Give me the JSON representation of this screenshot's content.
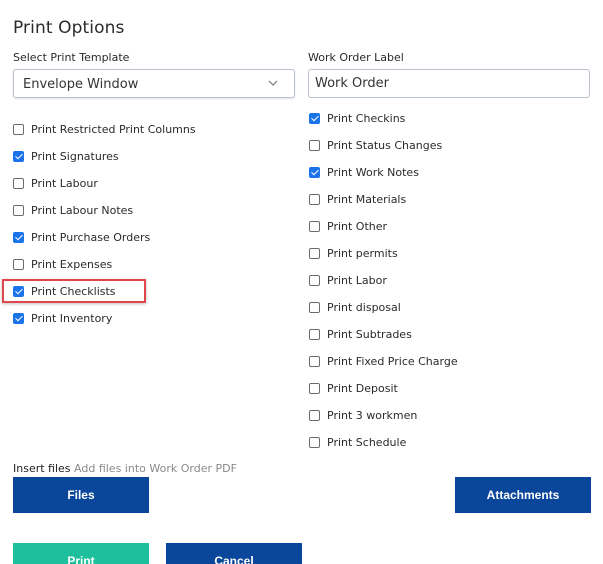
{
  "title": "Print Options",
  "template_select": {
    "label": "Select Print Template",
    "value": "Envelope Window"
  },
  "work_order_label": {
    "label": "Work Order Label",
    "value": "Work Order"
  },
  "left_options": [
    {
      "label": "Print Restricted Print Columns",
      "checked": false
    },
    {
      "label": "Print Signatures",
      "checked": true
    },
    {
      "label": "Print Labour",
      "checked": false
    },
    {
      "label": "Print Labour Notes",
      "checked": false
    },
    {
      "label": "Print Purchase Orders",
      "checked": true
    },
    {
      "label": "Print Expenses",
      "checked": false
    },
    {
      "label": "Print Checklists",
      "checked": true
    },
    {
      "label": "Print Inventory",
      "checked": true
    }
  ],
  "right_options": [
    {
      "label": "Print Checkins",
      "checked": true
    },
    {
      "label": "Print Status Changes",
      "checked": false
    },
    {
      "label": "Print Work Notes",
      "checked": true
    },
    {
      "label": "Print Materials",
      "checked": false
    },
    {
      "label": "Print Other",
      "checked": false
    },
    {
      "label": "Print permits",
      "checked": false
    },
    {
      "label": "Print Labor",
      "checked": false
    },
    {
      "label": "Print disposal",
      "checked": false
    },
    {
      "label": "Print Subtrades",
      "checked": false
    },
    {
      "label": "Print Fixed Price Charge",
      "checked": false
    },
    {
      "label": "Print Deposit",
      "checked": false
    },
    {
      "label": "Print 3 workmen",
      "checked": false
    },
    {
      "label": "Print Schedule",
      "checked": false
    }
  ],
  "insert_files": {
    "label": "Insert files",
    "hint": "Add files into Work Order PDF"
  },
  "buttons": {
    "files": "Files",
    "attachments": "Attachments",
    "print": "Print",
    "cancel": "Cancel"
  },
  "colors": {
    "primary_blue": "#0a479a",
    "print_green": "#1ebf9c",
    "checkbox_blue": "#1a73e8",
    "highlight_red": "#e0474c"
  }
}
